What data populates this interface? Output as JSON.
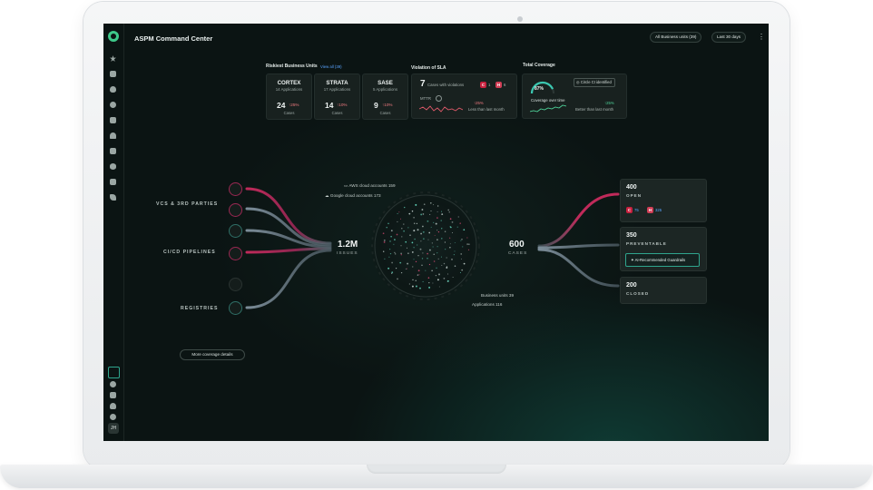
{
  "header": {
    "title": "ASPM Command Center",
    "business_units_filter": "All Business units (39)",
    "date_filter": "Last 30 days"
  },
  "riskiest": {
    "title": "Riskiest Business Units",
    "view_all": "View all (39)",
    "units": [
      {
        "name": "CORTEX",
        "apps": "14 Applications",
        "count": "24",
        "trend": "25%",
        "sub": "Cases"
      },
      {
        "name": "STRATA",
        "apps": "17 Applications",
        "count": "14",
        "trend": "10%",
        "sub": "Cases"
      },
      {
        "name": "SASE",
        "apps": "5 Applications",
        "count": "9",
        "trend": "10%",
        "sub": "Cases"
      }
    ]
  },
  "sla": {
    "title": "Violation of SLA",
    "count": "7",
    "count_label": "Cases with violations",
    "badge_c_label": "C",
    "badge_c_value": "1",
    "badge_h_label": "H",
    "badge_h_value": "6",
    "mttr_label": "MTTR",
    "mttr_trend": "25%",
    "mttr_sub": "Less than last month"
  },
  "coverage": {
    "title": "Total Coverage",
    "percent": "87%",
    "percent_value": 0.87,
    "identified_badge": "Circle CI identified",
    "over_time_label": "Coverage over time",
    "trend": "25%",
    "trend_sub": "Better than last month"
  },
  "flow": {
    "sources": [
      {
        "label": "VCS & 3RD PARTIES"
      },
      {
        "label": "CI/CD PIPELINES"
      },
      {
        "label": "REGISTRIES"
      }
    ],
    "source_icons": [
      "github-icon",
      "gitlab-icon",
      "cross-tool-icon",
      "jenkins-icon",
      "circleci-icon",
      "registry-icon"
    ],
    "issues_value": "1.2M",
    "issues_label": "ISSUES",
    "aws_label": "AWS cloud accounts 159",
    "gcp_label": "Google cloud accounts 173",
    "business_units_label": "Business units 39",
    "applications_label": "Applications 116",
    "cases_value": "600",
    "cases_label": "CASES"
  },
  "outcomes": {
    "open": {
      "value": "400",
      "label": "OPEN",
      "c_label": "C",
      "c_value": "75",
      "h_label": "H",
      "h_value": "325"
    },
    "preventable": {
      "value": "350",
      "label": "PREVENTABLE",
      "button": "AI-Recommended Guardrails"
    },
    "closed": {
      "value": "200",
      "label": "CLOSED"
    }
  },
  "more_coverage_button": "More coverage details",
  "user_initials": "JH",
  "colors": {
    "accent_green": "#3ec98a",
    "critical_red": "#c8203e",
    "flow_pink": "#c02a5a",
    "background": "#0b1413"
  }
}
